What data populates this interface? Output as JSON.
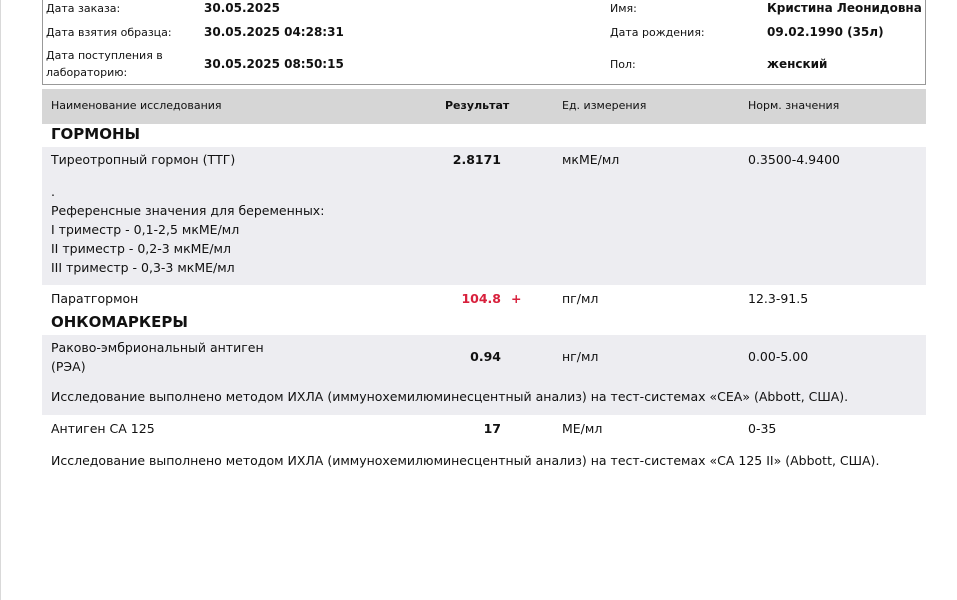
{
  "header": {
    "order_date_label": "Дата заказа:",
    "order_date": "30.05.2025",
    "sample_date_label": "Дата взятия образца:",
    "sample_date": "30.05.2025 04:28:31",
    "lab_date_label_1": "Дата поступления в",
    "lab_date_label_2": "лабораторию:",
    "lab_date": "30.05.2025 08:50:15",
    "name_label": "Имя:",
    "name": "Кристина Леонидовна",
    "birth_label": "Дата рождения:",
    "birth": "09.02.1990 (35л)",
    "sex_label": "Пол:",
    "sex": "женский"
  },
  "table_header": {
    "name": "Наименование исследования",
    "result": "Результат",
    "unit": "Ед. измерения",
    "norm": "Норм. значения"
  },
  "sections": {
    "hormones": "ГОРМОНЫ",
    "oncomarkers": "ОНКОМАРКЕРЫ"
  },
  "rows": {
    "tsh": {
      "name": "Тиреотропный гормон (ТТГ)",
      "result": "2.8171",
      "unit": "мкМЕ/мл",
      "norm": "0.3500-4.9400",
      "ref": [
        ".",
        "Референсные значения для беременных:",
        "I триместр - 0,1-2,5 мкМЕ/мл",
        "II триместр - 0,2-3 мкМЕ/мл",
        "III триместр - 0,3-3 мкМЕ/мл"
      ]
    },
    "pth": {
      "name": "Паратгормон",
      "result": "104.8",
      "flag": "+",
      "unit": "пг/мл",
      "norm": "12.3-91.5",
      "result_color": "#d8203c"
    },
    "cea": {
      "name_1": "Раково-эмбриональный антиген",
      "name_2": "(РЭА)",
      "result": "0.94",
      "unit": "нг/мл",
      "norm": "0.00-5.00",
      "note": "Исследование выполнено методом ИХЛА (иммунохемилюминесцентный анализ) на тест-системах «CEA» (Abbott, США)."
    },
    "ca125": {
      "name": "Антиген СА 125",
      "result": "17",
      "unit": "МЕ/мл",
      "norm": "0-35",
      "note": "Исследование выполнено методом ИХЛА (иммунохемилюминесцентный анализ) на тест-системах «CA 125 II» (Abbott, США)."
    }
  }
}
